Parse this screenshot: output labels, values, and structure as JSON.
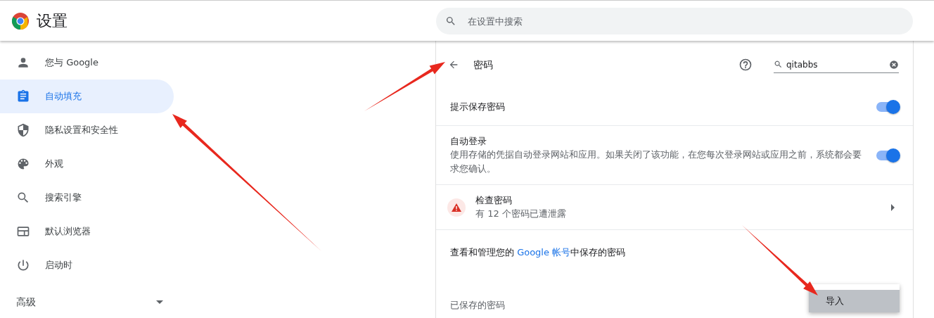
{
  "header": {
    "title": "设置",
    "search": {
      "placeholder": "在设置中搜索"
    }
  },
  "sidebar": {
    "items": [
      {
        "label": "您与 Google",
        "selected": false
      },
      {
        "label": "自动填充",
        "selected": true
      },
      {
        "label": "隐私设置和安全性",
        "selected": false
      },
      {
        "label": "外观",
        "selected": false
      },
      {
        "label": "搜索引擎",
        "selected": false
      },
      {
        "label": "默认浏览器",
        "selected": false
      },
      {
        "label": "启动时",
        "selected": false
      }
    ],
    "advanced": {
      "label": "高级",
      "expanded": false
    }
  },
  "passwords": {
    "title": "密码",
    "search": {
      "value": "qitabbs"
    },
    "settings": [
      {
        "kind": "toggle",
        "title": "提示保存密码",
        "on": true
      },
      {
        "kind": "toggle",
        "title": "自动登录",
        "description": "使用存储的凭据自动登录网站和应用。如果关闭了该功能，在您每次登录网站或应用之前，系统都会要求您确认。",
        "on": true
      },
      {
        "kind": "link",
        "title": "检查密码",
        "description": "有 12 个密码已遭泄露"
      }
    ],
    "account_note": {
      "before": "查看和管理您的 ",
      "link": "Google 帐号",
      "after": "中保存的密码"
    },
    "saved_heading": "已保存的密码",
    "menu": {
      "items": [
        {
          "label": "导入",
          "selected": true
        }
      ]
    }
  }
}
